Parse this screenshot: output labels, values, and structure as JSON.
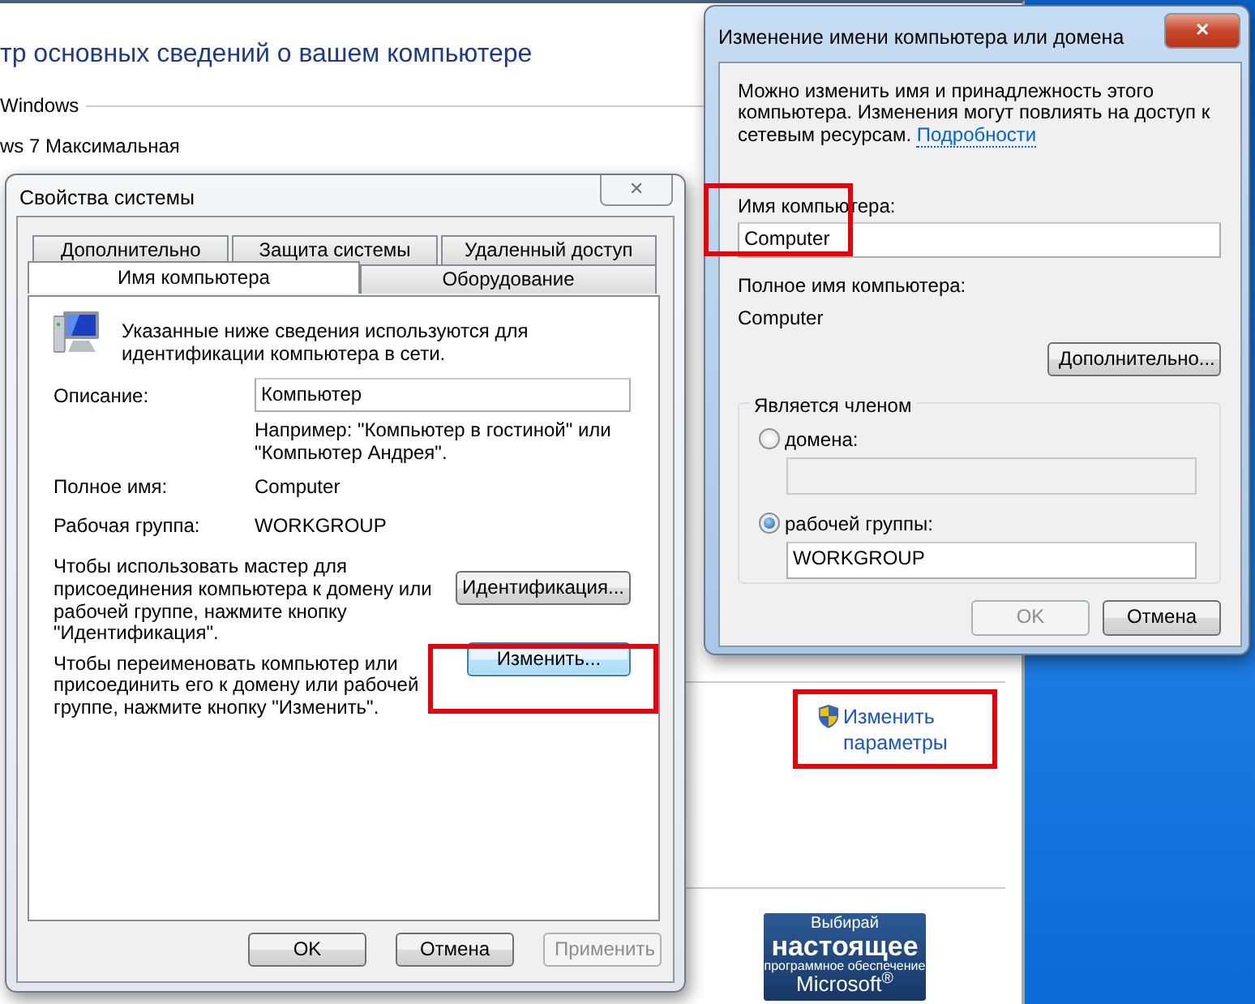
{
  "background_page": {
    "heading": "тр основных сведений о вашем компьютере",
    "section_label": "Windows",
    "edition": "ws 7 Максимальная",
    "change_settings_link": "Изменить параметры",
    "genuine_badge": [
      "Выбирай",
      "настоящее",
      "программное обеспечение",
      "Microsoft$^{®}$"
    ]
  },
  "system_properties": {
    "title": "Свойства системы",
    "close": "✕",
    "tab_rows": [
      [
        {
          "label": "Дополнительно",
          "selected": false
        },
        {
          "label": "Защита системы",
          "selected": false
        },
        {
          "label": "Удаленный доступ",
          "selected": false
        }
      ],
      [
        {
          "label": "Имя компьютера",
          "selected": true
        },
        {
          "label": "Оборудование",
          "selected": false
        }
      ]
    ],
    "intro": "Указанные ниже сведения используются для идентификации компьютера в сети.",
    "description_label": "Описание:",
    "description_value": "Компьютер",
    "example": "Например: \"Компьютер в гостиной\" или \"Компьютер Андрея\".",
    "full_name_label": "Полное имя:",
    "full_name_value": "Computer",
    "workgroup_label": "Рабочая группа:",
    "workgroup_value": "WORKGROUP",
    "actions": [
      {
        "text": "Чтобы использовать мастер для присоединения компьютера к домену или рабочей группе, нажмите кнопку \"Идентификация\".",
        "button": "Идентификация...",
        "focused": false
      },
      {
        "text": "Чтобы переименовать компьютер или присоединить его к домену или рабочей группе, нажмите кнопку \"Изменить\".",
        "button": "Изменить...",
        "focused": true
      }
    ],
    "buttons": [
      {
        "label": "OK",
        "disabled": false
      },
      {
        "label": "Отмена",
        "disabled": false
      },
      {
        "label": "Применить",
        "disabled": true
      }
    ]
  },
  "rename_dialog": {
    "title": "Изменение имени компьютера или домена",
    "close": "✕",
    "description": "Можно изменить имя и принадлежность этого компьютера. Изменения могут повлиять на доступ к сетевым ресурсам.",
    "details_link": "Подробности",
    "name_label": "Имя компьютера:",
    "name_value": "Computer",
    "full_name_label": "Полное имя компьютера:",
    "full_name_value": "Computer",
    "more_button": "Дополнительно...",
    "membership": {
      "label": "Является членом",
      "options": [
        {
          "label": "домена:",
          "selected": false
        },
        {
          "label": "рабочей группы:",
          "selected": true,
          "value": "WORKGROUP"
        }
      ]
    },
    "buttons": [
      {
        "label": "OK",
        "disabled": true
      },
      {
        "label": "Отмена",
        "disabled": false
      }
    ]
  }
}
